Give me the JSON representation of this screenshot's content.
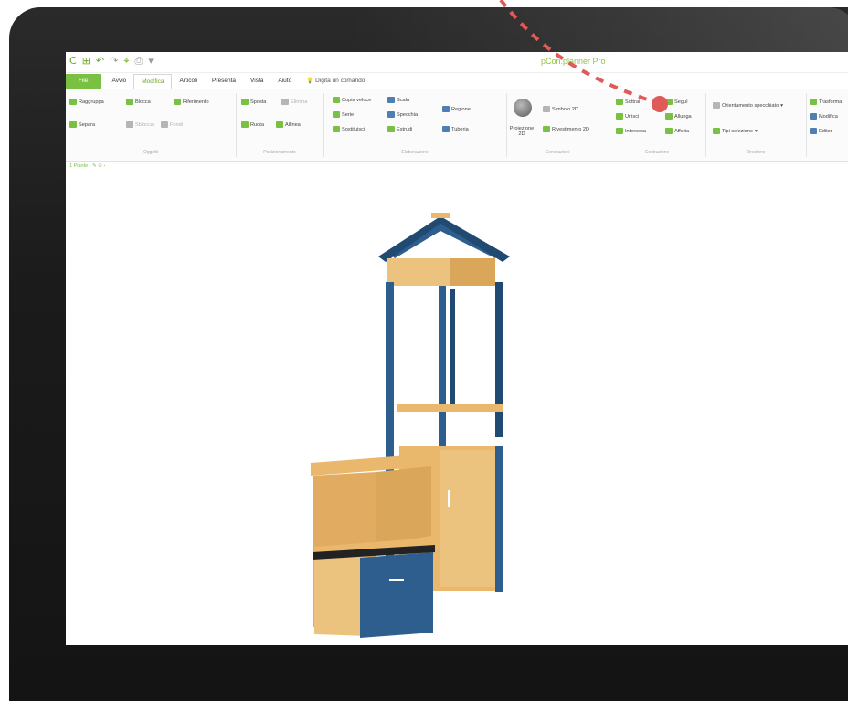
{
  "app_title": "pCon.planner Pro",
  "quick_access": [
    "C",
    "⊞",
    "↶",
    "↷",
    "⌖",
    "⎙",
    "▾"
  ],
  "tabs": {
    "file": "File",
    "items": [
      "Avvio",
      "Modifica",
      "Articoli",
      "Presenta",
      "Vista",
      "Aiuto"
    ],
    "active": "Modifica",
    "search": "Digita un comando"
  },
  "ribbon": {
    "groups": [
      {
        "label": "Oggetti",
        "commands": [
          "Raggruppa",
          "Blocca",
          "Riferimento",
          "Separa",
          "Sblocca",
          "Fondi"
        ]
      },
      {
        "label": "Posizionamento",
        "commands": [
          "Sposta",
          "Elimina",
          "Ruota",
          "Allinea"
        ]
      },
      {
        "label": "Elaborazione",
        "commands": [
          "Copia veloce",
          "Scala",
          "Regione",
          "Serie",
          "Specchia",
          "Sostituisci",
          "Estrudi",
          "Tuberia"
        ]
      },
      {
        "label": "Generazioni",
        "commands": [
          "Proiezione 2D",
          "Simbolo 2D",
          "Rivestimento 2D"
        ]
      },
      {
        "label": "Costruzione",
        "commands": [
          "Sottrai",
          "Seguì",
          "Unisci",
          "Allunga",
          "Interseca",
          "Affetta"
        ]
      },
      {
        "label": "Direzione",
        "commands": [
          "Orientamento specchiato",
          "Tipi selezione"
        ]
      },
      {
        "label": "",
        "commands": [
          "Trasforma",
          "Modifica",
          "Editor"
        ]
      }
    ]
  },
  "breadcrumb": "1 Piante ›",
  "colors": {
    "accent": "#7ac143",
    "bezel": "#1b1b1b",
    "marker": "#e05a5a",
    "furniture_wood": "#e9b86d",
    "furniture_blue": "#2d5e8e"
  }
}
